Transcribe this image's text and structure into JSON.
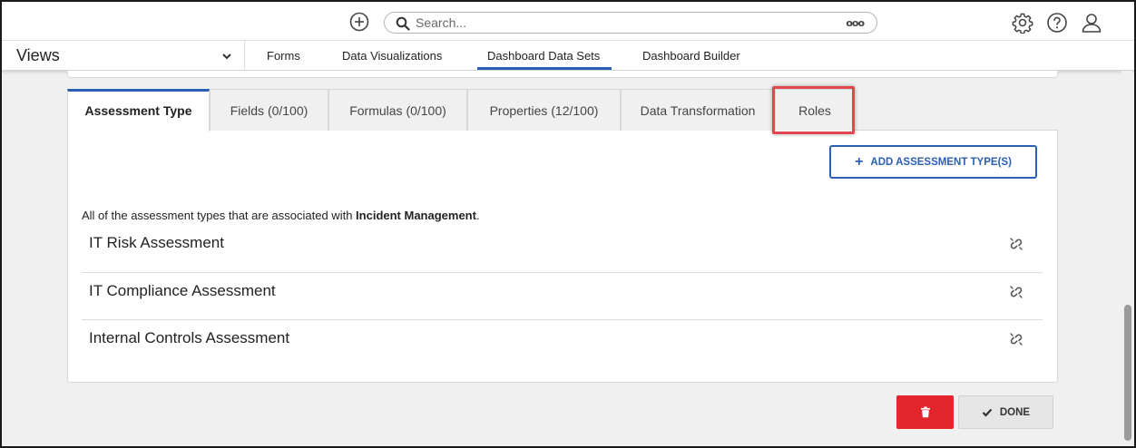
{
  "topbar": {
    "search_placeholder": "Search...",
    "more_glyph": "ooo",
    "icons": [
      "add-circle-icon",
      "search-icon",
      "more-icon",
      "gear-icon",
      "help-icon",
      "user-icon"
    ]
  },
  "navbar": {
    "views_label": "Views",
    "tabs": [
      {
        "label": "Forms"
      },
      {
        "label": "Data Visualizations"
      },
      {
        "label": "Dashboard Data Sets",
        "active": true
      },
      {
        "label": "Dashboard Builder"
      }
    ]
  },
  "tabs": [
    {
      "label": "Assessment Type",
      "active": true
    },
    {
      "label": "Fields (0/100)"
    },
    {
      "label": "Formulas (0/100)"
    },
    {
      "label": "Properties (12/100)"
    },
    {
      "label": "Data Transformation"
    },
    {
      "label": "Roles",
      "highlighted": true
    }
  ],
  "panel": {
    "add_button_label": "ADD ASSESSMENT TYPE(S)",
    "description_prefix": "All of the assessment types that are associated with ",
    "description_bold": "Incident Management",
    "description_suffix": ".",
    "items": [
      {
        "label": "IT Risk Assessment"
      },
      {
        "label": "IT Compliance Assessment"
      },
      {
        "label": "Internal Controls Assessment"
      }
    ]
  },
  "footer": {
    "done_label": "DONE"
  },
  "colors": {
    "accent": "#2b5fb4",
    "danger": "#e3262d",
    "highlight": "#e3474e"
  }
}
